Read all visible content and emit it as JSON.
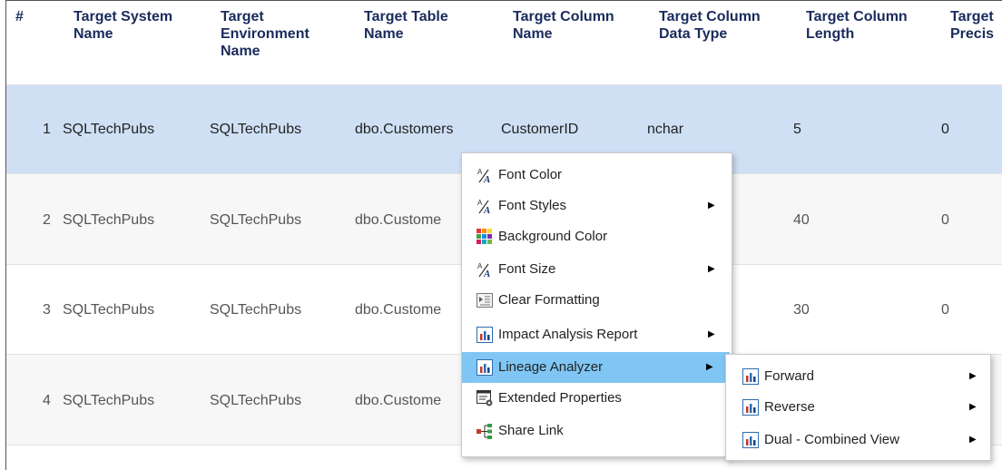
{
  "table": {
    "headers": [
      [
        "#"
      ],
      [
        "Target System",
        "Name"
      ],
      [
        "Target",
        "Environment",
        "Name"
      ],
      [
        "Target Table",
        "Name"
      ],
      [
        "Target Column",
        "Name"
      ],
      [
        "Target Column",
        "Data Type"
      ],
      [
        "Target Column",
        "Length"
      ],
      [
        "Target",
        "Precis"
      ]
    ],
    "rows": [
      {
        "num": "1",
        "system": "SQLTechPubs",
        "env": "SQLTechPubs",
        "table": "dbo.Customers",
        "column": "CustomerID",
        "dtype": "nchar",
        "length": "5",
        "precision": "0"
      },
      {
        "num": "2",
        "system": "SQLTechPubs",
        "env": "SQLTechPubs",
        "table": "dbo.Custome",
        "column": "",
        "dtype": "",
        "length": "40",
        "precision": "0"
      },
      {
        "num": "3",
        "system": "SQLTechPubs",
        "env": "SQLTechPubs",
        "table": "dbo.Custome",
        "column": "",
        "dtype": "",
        "length": "30",
        "precision": "0"
      },
      {
        "num": "4",
        "system": "SQLTechPubs",
        "env": "SQLTechPubs",
        "table": "dbo.Custome",
        "column": "",
        "dtype": "",
        "length": "",
        "precision": ""
      }
    ]
  },
  "context_menu": {
    "items": [
      {
        "label": "Font Color",
        "icon": "font-color-icon",
        "submenu": false
      },
      {
        "label": "Font Styles",
        "icon": "font-styles-icon",
        "submenu": true
      },
      {
        "label": "Background Color",
        "icon": "background-color-icon",
        "submenu": false
      },
      {
        "label": "Font Size",
        "icon": "font-size-icon",
        "submenu": true
      },
      {
        "label": "Clear Formatting",
        "icon": "clear-formatting-icon",
        "submenu": false
      },
      {
        "label": "Impact Analysis Report",
        "icon": "report-chart-icon",
        "submenu": true
      },
      {
        "label": "Lineage Analyzer",
        "icon": "report-chart-icon",
        "submenu": true,
        "active": true
      },
      {
        "label": "Extended Properties",
        "icon": "extended-properties-icon",
        "submenu": false
      },
      {
        "label": "Share Link",
        "icon": "share-link-icon",
        "submenu": false
      }
    ]
  },
  "lineage_submenu": {
    "items": [
      {
        "label": "Forward",
        "icon": "report-chart-icon"
      },
      {
        "label": "Reverse",
        "icon": "report-chart-icon"
      },
      {
        "label": "Dual - Combined View",
        "icon": "report-chart-icon"
      }
    ]
  },
  "colors": {
    "selected_row": "#cfe0f5",
    "menu_active": "#80c6f4",
    "header_text": "#1a2b5c"
  }
}
